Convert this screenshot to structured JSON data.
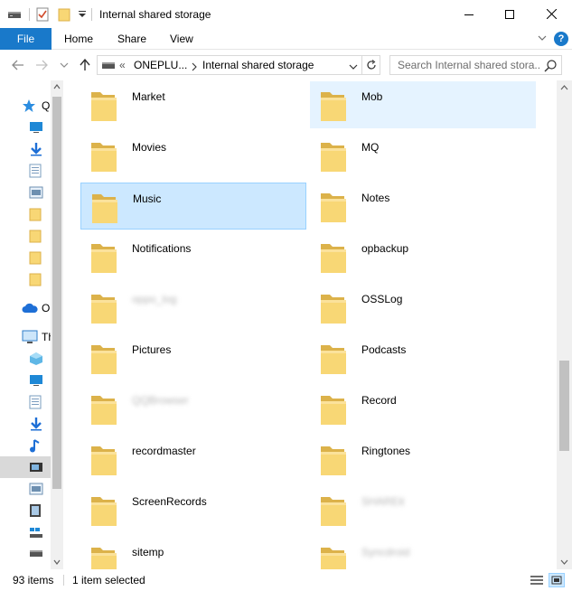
{
  "window": {
    "title": "Internal shared storage"
  },
  "ribbon": {
    "tabs": [
      {
        "label": "File"
      },
      {
        "label": "Home"
      },
      {
        "label": "Share"
      },
      {
        "label": "View"
      }
    ],
    "help_label": "?"
  },
  "address": {
    "overflow": "«",
    "segments": [
      "ONEPLU...",
      "Internal shared storage"
    ]
  },
  "search": {
    "placeholder": "Search Internal shared stora..."
  },
  "navpane": {
    "labels": [
      "Q",
      "O",
      "Th"
    ]
  },
  "items": [
    {
      "name": "Market",
      "col": 0,
      "row": 0,
      "state": ""
    },
    {
      "name": "Mob",
      "col": 1,
      "row": 0,
      "state": "hover"
    },
    {
      "name": "Movies",
      "col": 0,
      "row": 1,
      "state": ""
    },
    {
      "name": "MQ",
      "col": 1,
      "row": 1,
      "state": ""
    },
    {
      "name": "Music",
      "col": 0,
      "row": 2,
      "state": "selected"
    },
    {
      "name": "Notes",
      "col": 1,
      "row": 2,
      "state": ""
    },
    {
      "name": "Notifications",
      "col": 0,
      "row": 3,
      "state": ""
    },
    {
      "name": "opbackup",
      "col": 1,
      "row": 3,
      "state": ""
    },
    {
      "name": "oppo_log",
      "col": 0,
      "row": 4,
      "state": "blurred"
    },
    {
      "name": "OSSLog",
      "col": 1,
      "row": 4,
      "state": ""
    },
    {
      "name": "Pictures",
      "col": 0,
      "row": 5,
      "state": ""
    },
    {
      "name": "Podcasts",
      "col": 1,
      "row": 5,
      "state": ""
    },
    {
      "name": "QQBrowser",
      "col": 0,
      "row": 6,
      "state": "blurred"
    },
    {
      "name": "Record",
      "col": 1,
      "row": 6,
      "state": ""
    },
    {
      "name": "recordmaster",
      "col": 0,
      "row": 7,
      "state": ""
    },
    {
      "name": "Ringtones",
      "col": 1,
      "row": 7,
      "state": ""
    },
    {
      "name": "ScreenRecords",
      "col": 0,
      "row": 8,
      "state": ""
    },
    {
      "name": "SHAREit",
      "col": 1,
      "row": 8,
      "state": "blurred"
    },
    {
      "name": "sitemp",
      "col": 0,
      "row": 9,
      "state": ""
    },
    {
      "name": "Syncdroid",
      "col": 1,
      "row": 9,
      "state": "blurred"
    }
  ],
  "status": {
    "count": "93 items",
    "selected": "1 item selected"
  },
  "colors": {
    "accent": "#1979ca",
    "selection": "#cce8ff",
    "folder": "#f8d775"
  }
}
